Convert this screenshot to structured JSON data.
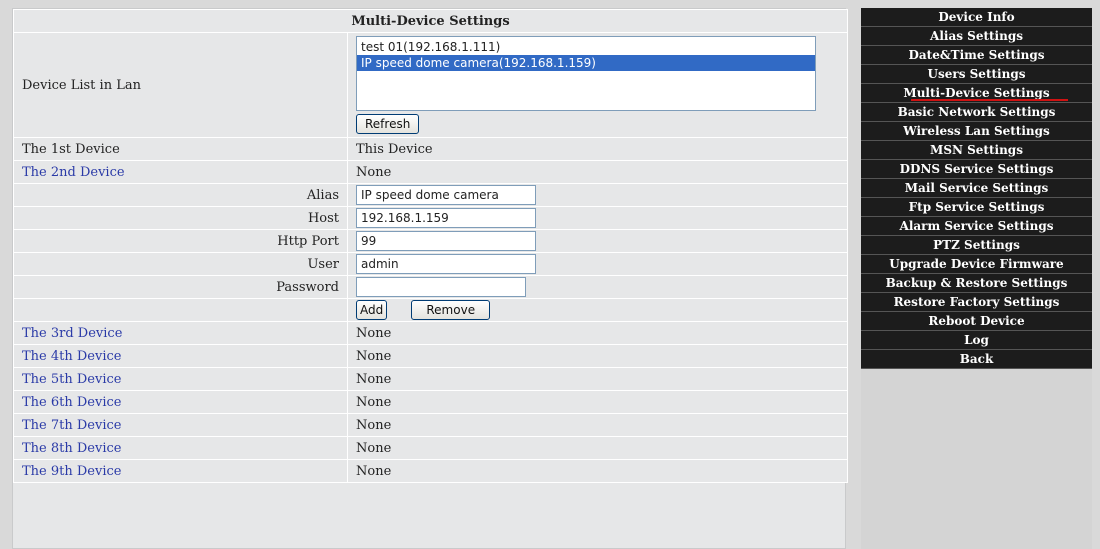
{
  "main": {
    "title": "Multi-Device Settings",
    "device_list_label": "Device List in Lan",
    "device_list": [
      {
        "text": "test 01(192.168.1.111)",
        "selected": false
      },
      {
        "text": "IP speed dome camera(192.168.1.159)",
        "selected": true
      }
    ],
    "refresh_label": "Refresh",
    "first_device": {
      "label": "The 1st Device",
      "value": "This Device"
    },
    "second_device": {
      "label": "The 2nd Device",
      "value": "None"
    },
    "form": {
      "alias_label": "Alias",
      "alias_value": "IP speed dome camera",
      "host_label": "Host",
      "host_value": "192.168.1.159",
      "http_port_label": "Http Port",
      "http_port_value": "99",
      "user_label": "User",
      "user_value": "admin",
      "password_label": "Password",
      "password_value": "",
      "add_label": "Add",
      "remove_label": "Remove"
    },
    "devices": [
      {
        "label": "The 3rd Device",
        "value": "None"
      },
      {
        "label": "The 4th Device",
        "value": "None"
      },
      {
        "label": "The 5th Device",
        "value": "None"
      },
      {
        "label": "The 6th Device",
        "value": "None"
      },
      {
        "label": "The 7th Device",
        "value": "None"
      },
      {
        "label": "The 8th Device",
        "value": "None"
      },
      {
        "label": "The 9th Device",
        "value": "None"
      }
    ]
  },
  "sidebar": {
    "items": [
      {
        "label": "Device Info"
      },
      {
        "label": "Alias Settings"
      },
      {
        "label": "Date&Time Settings"
      },
      {
        "label": "Users Settings"
      },
      {
        "label": "Multi-Device Settings",
        "active": true
      },
      {
        "label": "Basic Network Settings"
      },
      {
        "label": "Wireless Lan Settings"
      },
      {
        "label": "MSN Settings"
      },
      {
        "label": "DDNS Service Settings"
      },
      {
        "label": "Mail Service Settings"
      },
      {
        "label": "Ftp Service Settings"
      },
      {
        "label": "Alarm Service Settings"
      },
      {
        "label": "PTZ Settings"
      },
      {
        "label": "Upgrade Device Firmware"
      },
      {
        "label": "Backup & Restore Settings"
      },
      {
        "label": "Restore Factory Settings"
      },
      {
        "label": "Reboot Device"
      },
      {
        "label": "Log"
      },
      {
        "label": "Back"
      }
    ]
  },
  "colors": {
    "device_link": "#2a3aa7",
    "panel_bg": "#e6e7e8",
    "menu_bg": "#1c1c1c",
    "active_underline": "#d01212",
    "selection_bg": "#316ac5"
  }
}
